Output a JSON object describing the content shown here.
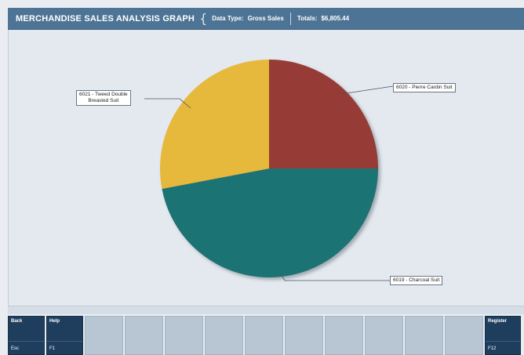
{
  "header": {
    "title": "MERCHANDISE SALES ANALYSIS GRAPH",
    "data_type_label": "Data Type:",
    "data_type_value": "Gross Sales",
    "totals_label": "Totals:",
    "totals_value": "$6,805.44"
  },
  "chart_data": {
    "type": "pie",
    "slices": [
      {
        "label": "6020 - Pierre Cardin Suit",
        "percent": 25,
        "color": "#963a36"
      },
      {
        "label": "6019 - Charcoal Suit",
        "percent": 47,
        "color": "#1f7373"
      },
      {
        "label": "6021 - Tweed Double Breasted Suit",
        "percent": 28,
        "color": "#e6b83a"
      }
    ],
    "callouts": {
      "left_line1": "6021 - Tweed Double",
      "left_line2": "Breasted Suit",
      "right_top": "6020 - Pierre Cardin Suit",
      "right_bottom": "6019 - Charcoal Suit"
    }
  },
  "function_keys": [
    {
      "label": "Back",
      "key": "Esc",
      "active": true
    },
    {
      "label": "Help",
      "key": "F1",
      "active": true
    },
    {
      "label": "",
      "key": "",
      "active": false
    },
    {
      "label": "",
      "key": "",
      "active": false
    },
    {
      "label": "",
      "key": "",
      "active": false
    },
    {
      "label": "",
      "key": "",
      "active": false
    },
    {
      "label": "",
      "key": "",
      "active": false
    },
    {
      "label": "",
      "key": "",
      "active": false
    },
    {
      "label": "",
      "key": "",
      "active": false
    },
    {
      "label": "",
      "key": "",
      "active": false
    },
    {
      "label": "",
      "key": "",
      "active": false
    },
    {
      "label": "",
      "key": "",
      "active": false
    },
    {
      "label": "Register",
      "key": "F12",
      "active": true
    }
  ]
}
